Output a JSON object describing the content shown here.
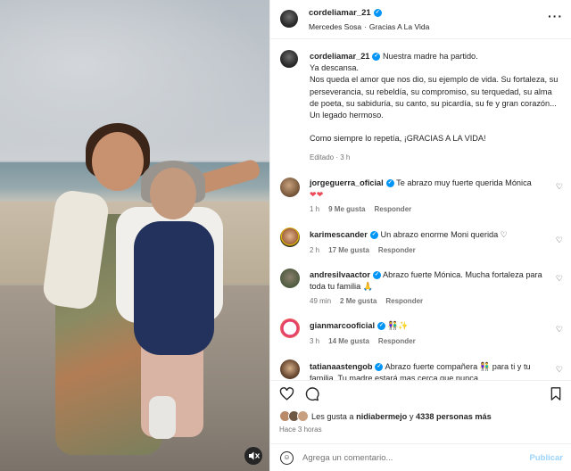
{
  "post": {
    "username": "cordeliamar_21",
    "audio": {
      "artist": "Mercedes Sosa",
      "separator": "·",
      "track": "Gracias A La Vida"
    }
  },
  "caption": {
    "username": "cordeliamar_21",
    "lines": [
      "Nuestra madre ha partido.",
      "Ya descansa.",
      "Nos queda el amor que nos dio, su ejemplo de vida. Su fortaleza, su perseverancia, su rebeldía, su compromiso, su terquedad, su alma de poeta, su sabiduría, su canto, su picardía, su fe y gran corazón...",
      "Un legado hermoso.",
      "Como siempre lo repetía, ¡GRACIAS A LA VIDA!"
    ],
    "edited": "Editado",
    "time": "3 h"
  },
  "comments": [
    {
      "username": "jorgeguerra_oficial",
      "verified": true,
      "text": "Te abrazo muy fuerte querida Mónica",
      "emoji_line": "❤❤",
      "time": "1 h",
      "likes": "9 Me gusta",
      "reply": "Responder"
    },
    {
      "username": "karimescander",
      "verified": true,
      "text": "Un abrazo enorme Moni querida ♡",
      "time": "2 h",
      "likes": "17 Me gusta",
      "reply": "Responder"
    },
    {
      "username": "andresilvaactor",
      "verified": true,
      "text": "Abrazo fuerte Mónica. Mucha fortaleza para toda tu familia 🙏",
      "time": "49 min",
      "likes": "2 Me gusta",
      "reply": "Responder"
    },
    {
      "username": "gianmarcooficial",
      "verified": true,
      "text": "👫✨",
      "time": "3 h",
      "likes": "14 Me gusta",
      "reply": "Responder"
    },
    {
      "username": "tatianaastengob",
      "verified": true,
      "text": "Abrazo fuerte compañera 👫 para ti y tu familia. Tu madre estará mas cerca que nunca",
      "time": "",
      "likes": "",
      "reply": ""
    }
  ],
  "footer": {
    "likes_prefix": "Les gusta a",
    "likes_user": "nidiabermejo",
    "likes_joiner": "y",
    "likes_count": "4338 personas más",
    "ago": "Hace 3 horas",
    "comment_placeholder": "Agrega un comentario...",
    "publish_label": "Publicar"
  },
  "icons": {
    "verified": "verified-badge",
    "more": "more-options-icon",
    "heart": "heart-icon",
    "comment": "comment-icon",
    "bookmark": "bookmark-icon",
    "emoji": "emoji-icon",
    "mute": "muted-speaker-icon"
  },
  "colors": {
    "verified": "#0095f6",
    "publish_disabled": "#9bd3fb",
    "secondary_text": "#737373",
    "heart_emoji": "#ed4956"
  }
}
